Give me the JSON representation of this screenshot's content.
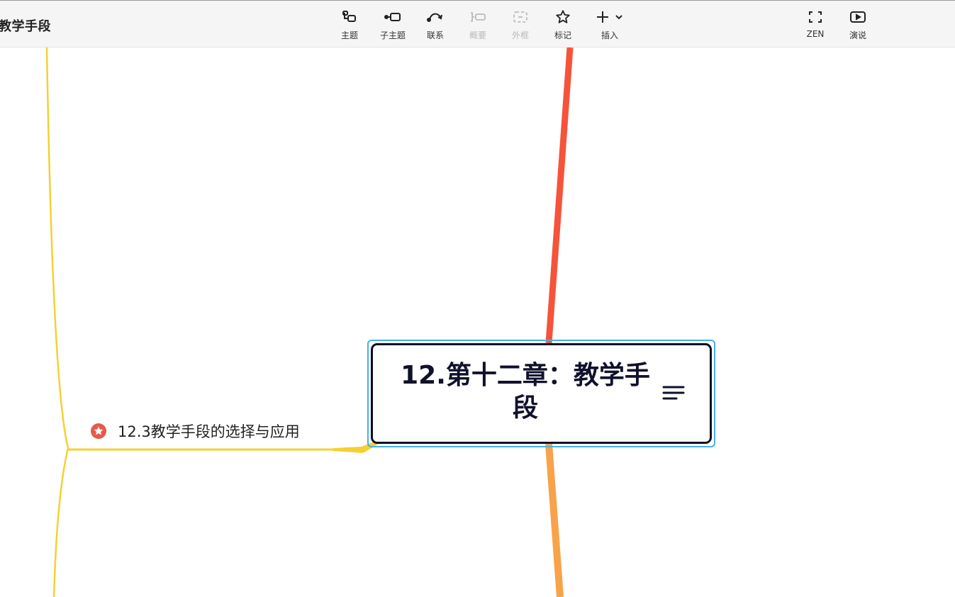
{
  "document": {
    "title": "教学手段"
  },
  "toolbar": {
    "items": [
      {
        "label": "主题",
        "icon": "topic-icon",
        "enabled": true
      },
      {
        "label": "子主题",
        "icon": "subtopic-icon",
        "enabled": true
      },
      {
        "label": "联系",
        "icon": "relationship-icon",
        "enabled": true
      },
      {
        "label": "概要",
        "icon": "summary-icon",
        "enabled": false
      },
      {
        "label": "外框",
        "icon": "boundary-icon",
        "enabled": false
      },
      {
        "label": "标记",
        "icon": "star-icon",
        "enabled": true
      },
      {
        "label": "插入",
        "icon": "plus-icon",
        "enabled": true
      },
      {
        "label": "ZEN",
        "icon": "fullscreen-icon",
        "enabled": true
      },
      {
        "label": "演说",
        "icon": "play-icon",
        "enabled": true
      }
    ]
  },
  "mindmap": {
    "central_topic": "12.第十二章：教学手段",
    "subtopics": [
      {
        "label": "12.3教学手段的选择与应用",
        "marker": "star-icon",
        "marker_color": "#e8584a"
      }
    ],
    "branch_colors": {
      "yellow": "#f5d032",
      "red": "#f5543a",
      "orange": "#f8a24a",
      "selection": "#46b0e8"
    }
  }
}
